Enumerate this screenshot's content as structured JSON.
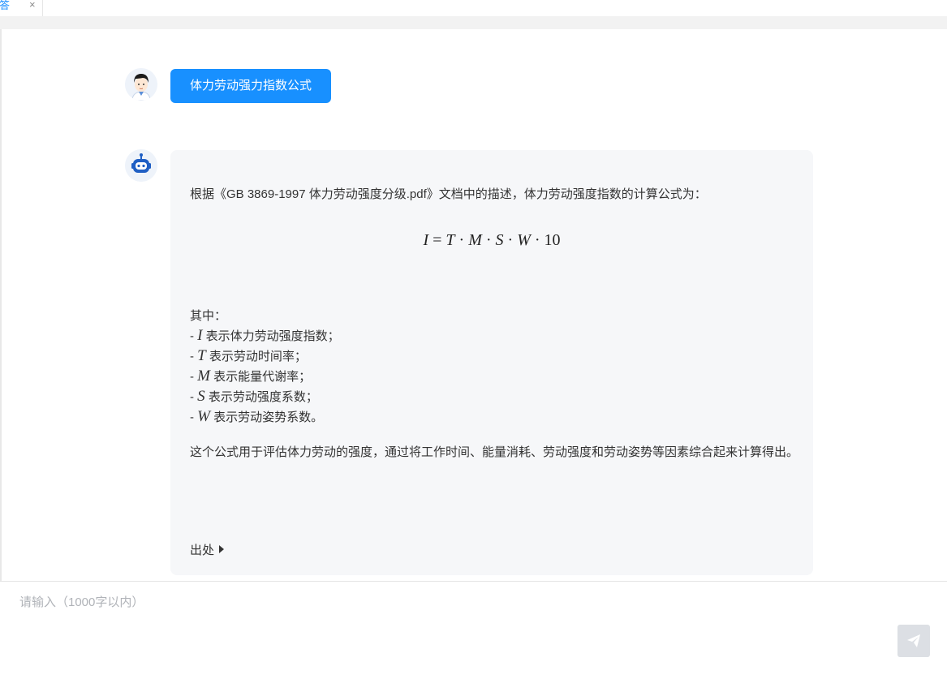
{
  "tab": {
    "label": "问答",
    "close_label": "×"
  },
  "conversation": {
    "user_message": "体力劳动强力指数公式",
    "bot_intro": "根据《GB 3869-1997 体力劳动强度分级.pdf》文档中的描述，体力劳动强度指数的计算公式为：",
    "formula": {
      "I": "I",
      "eq": " = ",
      "T": "T",
      "M": "M",
      "S": "S",
      "W": "W",
      "dot": " · ",
      "const": "10"
    },
    "definitions_heading": "其中：",
    "definitions": [
      {
        "symbol": "I",
        "text": " 表示体力劳动强度指数；"
      },
      {
        "symbol": "T",
        "text": " 表示劳动时间率；"
      },
      {
        "symbol": "M",
        "text": " 表示能量代谢率；"
      },
      {
        "symbol": "S",
        "text": " 表示劳动强度系数；"
      },
      {
        "symbol": "W",
        "text": " 表示劳动姿势系数。"
      }
    ],
    "summary": "这个公式用于评估体力劳动的强度，通过将工作时间、能量消耗、劳动强度和劳动姿势等因素综合起来计算得出。",
    "source_label": "出处"
  },
  "input": {
    "placeholder": "请输入（1000字以内）"
  },
  "colors": {
    "accent": "#1890ff",
    "bubble_bg": "#f6f7f9",
    "send_bg": "#dcdfe4"
  },
  "icons": {
    "user_avatar": "user-avatar-icon",
    "bot_avatar": "robot-avatar-icon",
    "send": "send-plane-icon",
    "close": "close-icon",
    "caret": "caret-right-icon"
  }
}
